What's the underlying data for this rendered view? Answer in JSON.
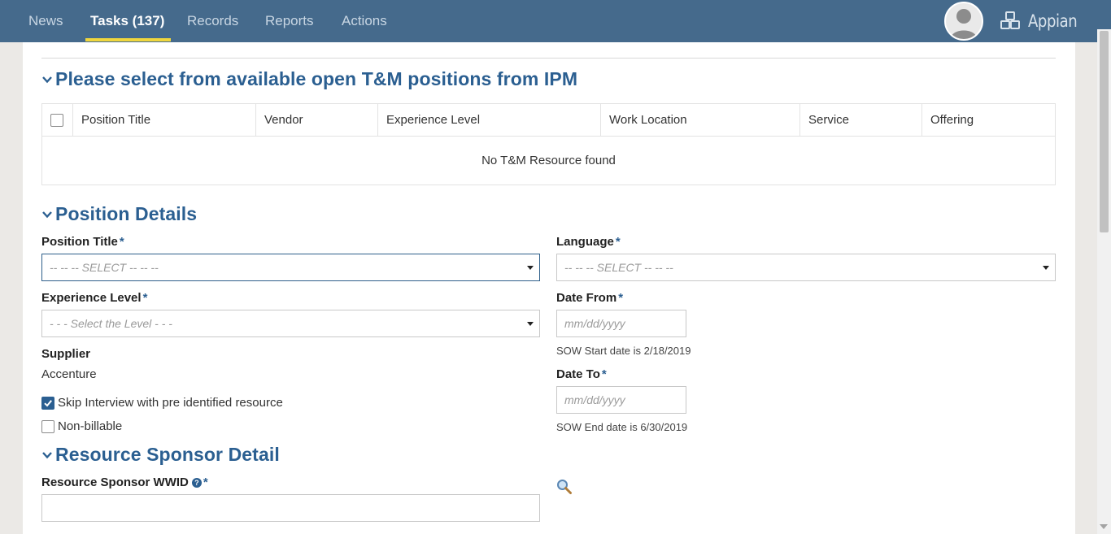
{
  "nav": {
    "tabs": [
      {
        "label": "News"
      },
      {
        "label": "Tasks (137)"
      },
      {
        "label": "Records"
      },
      {
        "label": "Reports"
      },
      {
        "label": "Actions"
      }
    ],
    "active_tab": "Tasks (137)",
    "brand": "Appian",
    "accent_color": "#f0d63d",
    "bar_color": "#456a8c"
  },
  "sections": {
    "positions": {
      "title": "Please select from available open T&M positions from IPM",
      "columns": [
        "Position Title",
        "Vendor",
        "Experience Level",
        "Work Location",
        "Service",
        "Offering"
      ],
      "empty_message": "No T&M Resource found"
    },
    "details": {
      "title": "Position Details",
      "position_title": {
        "label": "Position Title",
        "placeholder": "-- -- -- SELECT -- -- --"
      },
      "language": {
        "label": "Language",
        "placeholder": "-- -- -- SELECT -- -- --"
      },
      "experience_level": {
        "label": "Experience Level",
        "placeholder": "- - - Select the Level - - -"
      },
      "date_from": {
        "label": "Date From",
        "placeholder": "mm/dd/yyyy",
        "hint": "SOW Start date is 2/18/2019"
      },
      "date_to": {
        "label": "Date To",
        "placeholder": "mm/dd/yyyy",
        "hint": "SOW End date is 6/30/2019"
      },
      "supplier": {
        "label": "Supplier",
        "value": "Accenture"
      },
      "skip_interview": {
        "label": "Skip Interview with pre identified resource",
        "checked": true
      },
      "non_billable": {
        "label": "Non-billable",
        "checked": false
      },
      "required_mark": "*"
    },
    "sponsor": {
      "title": "Resource Sponsor Detail",
      "wwid": {
        "label": "Resource Sponsor WWID",
        "value": ""
      }
    }
  },
  "colors": {
    "section_title": "#2b5f91",
    "checkbox_checked": "#2b5f91"
  }
}
